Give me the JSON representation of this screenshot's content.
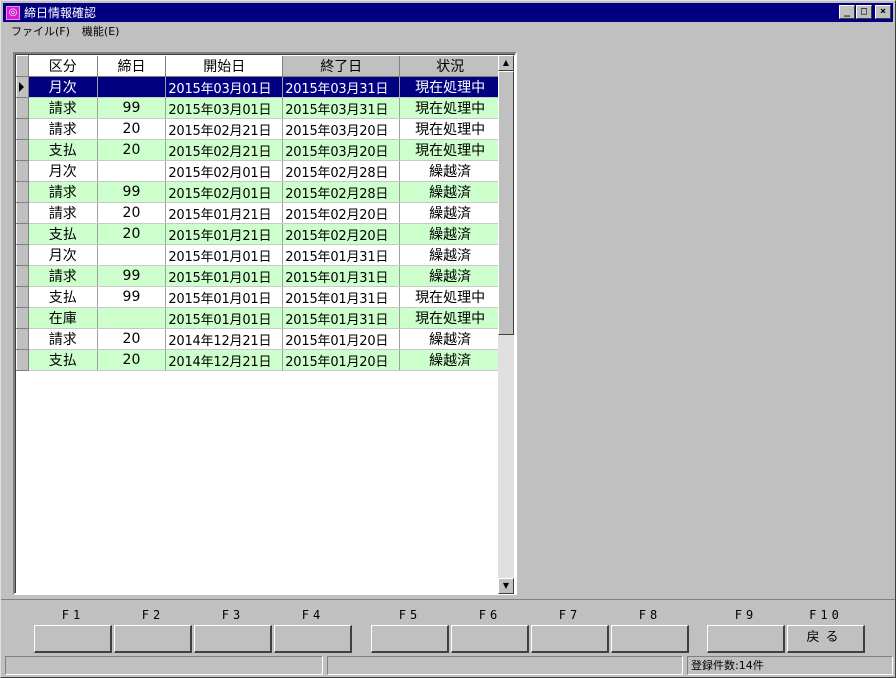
{
  "window": {
    "title": "締日情報確認",
    "icon": "app-icon"
  },
  "menu": [
    {
      "label": "ファイル(F)"
    },
    {
      "label": "機能(E)"
    }
  ],
  "grid": {
    "columns": [
      "区分",
      "締日",
      "開始日",
      "終了日",
      "状況"
    ],
    "rows": [
      {
        "kubun": "月次",
        "shime": "",
        "start": "2015年03月01日",
        "end": "2015年03月31日",
        "status": "現在処理中"
      },
      {
        "kubun": "請求",
        "shime": "99",
        "start": "2015年03月01日",
        "end": "2015年03月31日",
        "status": "現在処理中"
      },
      {
        "kubun": "請求",
        "shime": "20",
        "start": "2015年02月21日",
        "end": "2015年03月20日",
        "status": "現在処理中"
      },
      {
        "kubun": "支払",
        "shime": "20",
        "start": "2015年02月21日",
        "end": "2015年03月20日",
        "status": "現在処理中"
      },
      {
        "kubun": "月次",
        "shime": "",
        "start": "2015年02月01日",
        "end": "2015年02月28日",
        "status": "繰越済"
      },
      {
        "kubun": "請求",
        "shime": "99",
        "start": "2015年02月01日",
        "end": "2015年02月28日",
        "status": "繰越済"
      },
      {
        "kubun": "請求",
        "shime": "20",
        "start": "2015年01月21日",
        "end": "2015年02月20日",
        "status": "繰越済"
      },
      {
        "kubun": "支払",
        "shime": "20",
        "start": "2015年01月21日",
        "end": "2015年02月20日",
        "status": "繰越済"
      },
      {
        "kubun": "月次",
        "shime": "",
        "start": "2015年01月01日",
        "end": "2015年01月31日",
        "status": "繰越済"
      },
      {
        "kubun": "請求",
        "shime": "99",
        "start": "2015年01月01日",
        "end": "2015年01月31日",
        "status": "繰越済"
      },
      {
        "kubun": "支払",
        "shime": "99",
        "start": "2015年01月01日",
        "end": "2015年01月31日",
        "status": "現在処理中"
      },
      {
        "kubun": "在庫",
        "shime": "",
        "start": "2015年01月01日",
        "end": "2015年01月31日",
        "status": "現在処理中"
      },
      {
        "kubun": "請求",
        "shime": "20",
        "start": "2014年12月21日",
        "end": "2015年01月20日",
        "status": "繰越済"
      },
      {
        "kubun": "支払",
        "shime": "20",
        "start": "2014年12月21日",
        "end": "2015年01月20日",
        "status": "繰越済"
      }
    ],
    "selected_row": 0,
    "colors": {
      "selected": "#000080",
      "alt_row": "#ccffcc"
    }
  },
  "function_keys": [
    {
      "key": "F1",
      "label": ""
    },
    {
      "key": "F2",
      "label": ""
    },
    {
      "key": "F3",
      "label": ""
    },
    {
      "key": "F4",
      "label": ""
    },
    {
      "key": "F5",
      "label": ""
    },
    {
      "key": "F6",
      "label": ""
    },
    {
      "key": "F7",
      "label": ""
    },
    {
      "key": "F8",
      "label": ""
    },
    {
      "key": "F9",
      "label": ""
    },
    {
      "key": "F10",
      "label": "戻る"
    }
  ],
  "status_bar": {
    "pane1": "",
    "pane2": "",
    "pane3": "登録件数:14件"
  }
}
